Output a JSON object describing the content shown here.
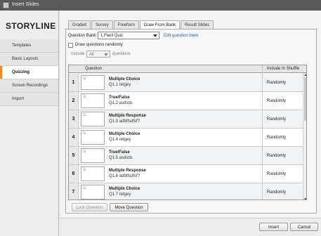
{
  "window": {
    "title": "Insert Slides"
  },
  "sidebar": {
    "logo": "STORYLINE",
    "items": [
      {
        "label": "Templates",
        "active": false
      },
      {
        "label": "Basic Layouts",
        "active": false
      },
      {
        "label": "Quizzing",
        "active": true
      },
      {
        "label": "Screen Recordings",
        "active": false
      },
      {
        "label": "Import",
        "active": false
      }
    ]
  },
  "tabs": [
    {
      "label": "Graded",
      "active": false
    },
    {
      "label": "Survey",
      "active": false
    },
    {
      "label": "Freeform",
      "active": false
    },
    {
      "label": "Draw From Bank",
      "active": true
    },
    {
      "label": "Result Slides",
      "active": false
    }
  ],
  "bank": {
    "label": "Question Bank:",
    "selected": "1 Flaril Quiz",
    "edit_link": "Edit question bank",
    "draw_random_label": "Draw questions randomly",
    "draw_random_checked": false,
    "include_label": "Include:",
    "include_value": "All",
    "include_suffix": "questions"
  },
  "table": {
    "headers": {
      "question": "Question",
      "include": "Include In Shuffle"
    },
    "rows": [
      {
        "num": "1",
        "type": "Multiple Choice",
        "text": "Q1.1 retgey",
        "include": "Randomly"
      },
      {
        "num": "2",
        "type": "True/False",
        "text": "Q1.2 asdsds",
        "include": "Randomly"
      },
      {
        "num": "3",
        "type": "Multiple Response",
        "text": "Q1.3 adfdfsdfsf?",
        "include": "Randomly"
      },
      {
        "num": "4",
        "type": "Multiple Choice",
        "text": "Q1.4 retgey",
        "include": "Randomly"
      },
      {
        "num": "5",
        "type": "True/False",
        "text": "Q1.5 asdsds",
        "include": "Randomly"
      },
      {
        "num": "6",
        "type": "Multiple Response",
        "text": "Q1.6 adfdfsdfsf?",
        "include": "Randomly"
      },
      {
        "num": "7",
        "type": "Multiple Choice",
        "text": "Q1.7 retgey",
        "include": "Randomly"
      }
    ]
  },
  "actions": {
    "lock": "Lock Question",
    "move": "Move Question"
  },
  "footer": {
    "insert": "Insert",
    "cancel": "Cancel"
  },
  "colors": {
    "accent": "#f28a20",
    "link": "#2a5db0",
    "titlebar": "#5a5a5a"
  }
}
